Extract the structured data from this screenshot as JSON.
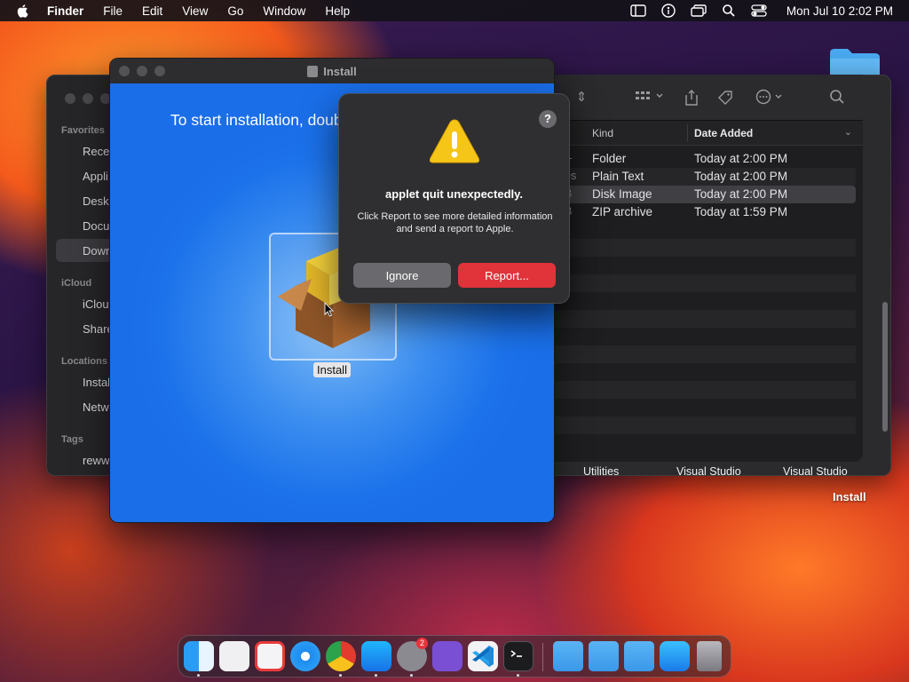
{
  "menubar": {
    "app_name": "Finder",
    "menus": [
      "File",
      "Edit",
      "View",
      "Go",
      "Window",
      "Help"
    ],
    "clock": "Mon Jul 10  2:02 PM"
  },
  "finder_sidebar": {
    "favorites_heading": "Favorites",
    "favorites": [
      "Rece",
      "Appli",
      "Desk",
      "Docu",
      "Down"
    ],
    "icloud_heading": "iCloud",
    "icloud": [
      "iClou",
      "Share"
    ],
    "locations_heading": "Locations",
    "locations": [
      "Instal",
      "Netw"
    ],
    "tags_heading": "Tags",
    "tags": [
      "rewww"
    ]
  },
  "finder_list": {
    "col_kind": "Kind",
    "col_date_added": "Date Added",
    "rows": [
      {
        "size": "--",
        "kind": "Folder",
        "date": "Today at 2:00 PM"
      },
      {
        "size": "es",
        "kind": "Plain Text",
        "date": "Today at 2:00 PM"
      },
      {
        "size": "B",
        "kind": "Disk Image",
        "date": "Today at 2:00 PM"
      },
      {
        "size": "B",
        "kind": "ZIP archive",
        "date": "Today at 1:59 PM"
      }
    ],
    "bottom_labels": [
      "Utilities",
      "Visual Studio",
      "Visual Studio"
    ]
  },
  "install_window": {
    "title": "Install",
    "instruction": "To start installation, doub",
    "package_label": "Install"
  },
  "alert": {
    "help": "?",
    "title": "applet quit unexpectedly.",
    "message": "Click Report to see more detailed information and send a report to Apple.",
    "ignore_label": "Ignore",
    "report_label": "Report..."
  },
  "desktop": {
    "install_label": "Install"
  },
  "dock": {
    "badge": "2",
    "apps": [
      "finder-icon",
      "windows-app-icon",
      "script-editor-icon",
      "safari-icon",
      "chrome-icon",
      "app-store-icon",
      "system-settings-icon",
      "visual-studio-icon",
      "vscode-icon",
      "terminal-icon",
      "folder-icon",
      "folder-icon",
      "applications-folder-icon",
      "downloads-icon",
      "trash-icon"
    ]
  },
  "colors": {
    "report_button": "#e0333a",
    "install_bg": "#1c72ea",
    "warning": "#f5c518"
  }
}
